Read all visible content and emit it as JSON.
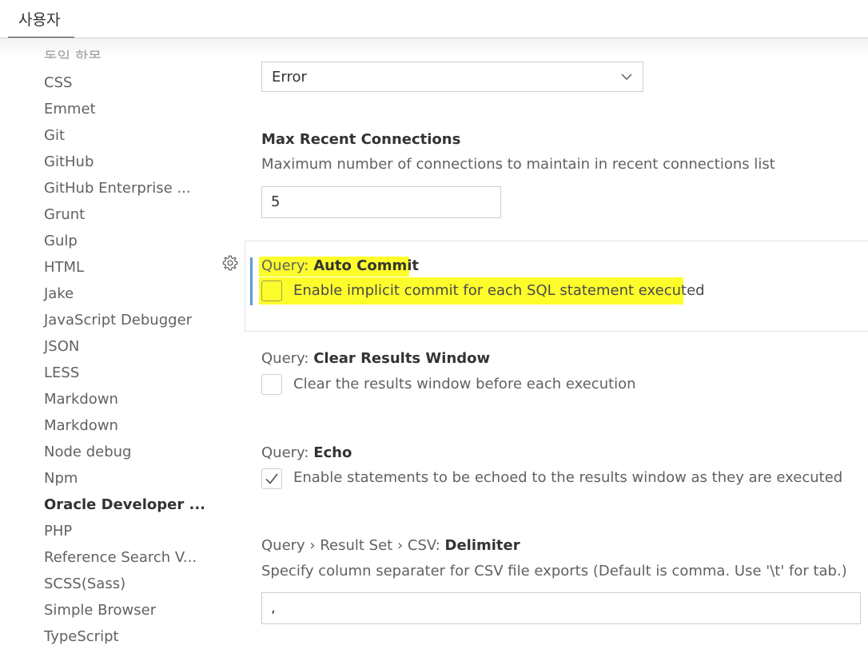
{
  "tab": {
    "label": "사용자"
  },
  "sidebar": {
    "partial_item": "동일 항목",
    "items": [
      {
        "label": "CSS"
      },
      {
        "label": "Emmet"
      },
      {
        "label": "Git"
      },
      {
        "label": "GitHub"
      },
      {
        "label": "GitHub Enterprise ..."
      },
      {
        "label": "Grunt"
      },
      {
        "label": "Gulp"
      },
      {
        "label": "HTML"
      },
      {
        "label": "Jake"
      },
      {
        "label": "JavaScript Debugger"
      },
      {
        "label": "JSON"
      },
      {
        "label": "LESS"
      },
      {
        "label": "Markdown"
      },
      {
        "label": "Markdown"
      },
      {
        "label": "Node debug"
      },
      {
        "label": "Npm"
      },
      {
        "label": "Oracle Developer ..."
      },
      {
        "label": "PHP"
      },
      {
        "label": "Reference Search V..."
      },
      {
        "label": "SCSS(Sass)"
      },
      {
        "label": "Simple Browser"
      },
      {
        "label": "TypeScript"
      }
    ],
    "active_index": 16
  },
  "settings": {
    "log_level": {
      "value": "Error"
    },
    "max_recent": {
      "title": "Max Recent Connections",
      "description": "Maximum number of connections to maintain in recent connections list",
      "value": "5"
    },
    "auto_commit": {
      "category": "Query: ",
      "name": "Auto Commit",
      "description": "Enable implicit commit for each SQL statement executed",
      "checked": false,
      "highlight_color": "#fdfd2c"
    },
    "clear_results": {
      "category": "Query: ",
      "name": "Clear Results Window",
      "description": "Clear the results window before each execution",
      "checked": false
    },
    "echo": {
      "category": "Query: ",
      "name": "Echo",
      "description": "Enable statements to be echoed to the results window as they are executed",
      "checked": true
    },
    "csv_delimiter": {
      "category": "Query › Result Set › CSV: ",
      "name": "Delimiter",
      "description": "Specify column separater for CSV file exports (Default is comma. Use '\\t' for tab.)",
      "value": ","
    }
  },
  "colors": {
    "focus_bar": "#5b9bd5",
    "highlight": "#fdfd2c"
  }
}
